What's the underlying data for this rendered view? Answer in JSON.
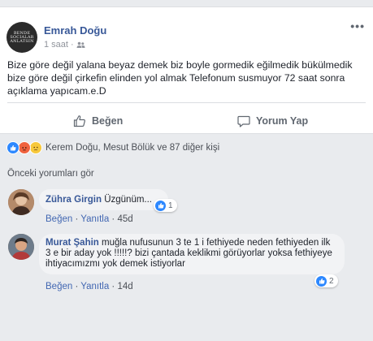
{
  "post": {
    "author": "Emrah Doğu",
    "avatar_text": "BENDE SOCIALAR ANLATSIN",
    "time": "1 saat ·",
    "audience_icon": "friends-icon",
    "more_label": "•••",
    "text": "Bize göre değil yalana beyaz demek biz boyle gormedik eğilmedik bükülmedik bize göre değil çirkefin elinden yol almak Telefonum susmuyor 72 saat sonra açıklama yapıcam.e.D"
  },
  "actions": {
    "like_label": "Beğen",
    "comment_label": "Yorum Yap"
  },
  "reactions": {
    "icons": [
      "like-icon",
      "angry-icon",
      "sad-icon"
    ],
    "summary": "Kerem Doğu, Mesut Bölük ve 87 diğer kişi"
  },
  "previous_comments_label": "Önceki yorumları gör",
  "comments": [
    {
      "author": "Zühra Girgin",
      "text": "Üzgünüm...",
      "like_label": "Beğen",
      "separator1": " · ",
      "reply_label": "Yanıtla",
      "separator2": " · ",
      "time": "45d",
      "like_count": "1"
    },
    {
      "author": "Murat Şahin",
      "text": "muğla nufusunun 3 te 1 i fethiyede neden fethiyeden ilk 3 e bir aday yok !!!!!? bizi çantada keklikmi görüyorlar yoksa fethiyeye ihtiyacımızmı yok demek istiyorlar",
      "like_label": "Beğen",
      "separator1": " · ",
      "reply_label": "Yanıtla",
      "separator2": " · ",
      "time": "14d",
      "like_count": "2"
    }
  ],
  "colors": {
    "link_blue": "#385898",
    "like_blue": "#2d88ff",
    "background": "#e9ebee"
  }
}
